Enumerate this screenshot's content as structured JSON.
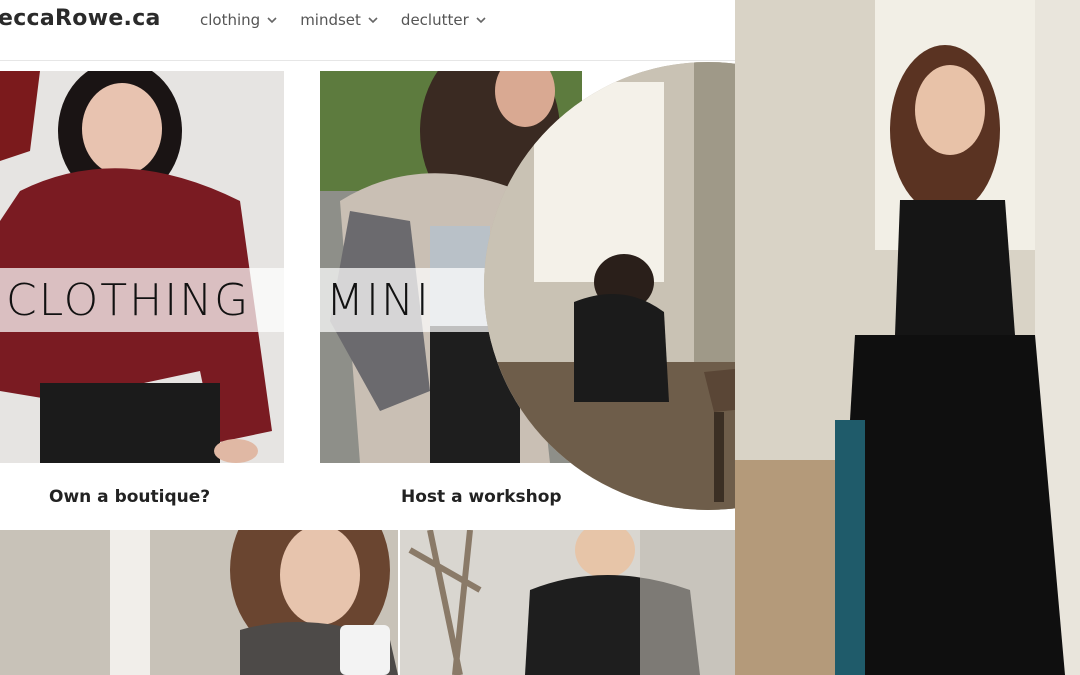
{
  "site": {
    "logo": "eccaRowe.ca",
    "nav": [
      {
        "label": "clothing"
      },
      {
        "label": "mindset"
      },
      {
        "label": "declutter"
      }
    ]
  },
  "cards": [
    {
      "overlay_text": "CLOTHING",
      "caption": "Own a boutique?"
    },
    {
      "overlay_text": "MINI",
      "caption": "Host a workshop"
    }
  ],
  "icons": {
    "nav_chevron": "chevron-down-icon"
  }
}
